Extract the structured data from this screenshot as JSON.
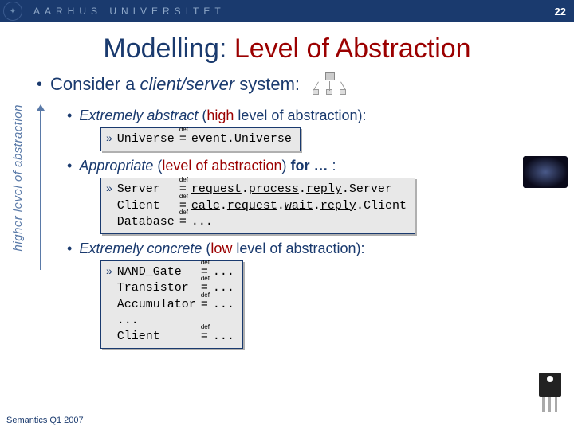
{
  "header": {
    "university": "AARHUS UNIVERSITET",
    "page_number": "22"
  },
  "title": {
    "plain": "Modelling: ",
    "accent": "Level of Abstraction"
  },
  "main_bullet": {
    "prefix": "Consider a ",
    "italic": "client/server",
    "suffix": " system:"
  },
  "vertical_label": "higher level of abstraction",
  "levels": [
    {
      "line_parts": [
        "Extremely abstract",
        " (",
        "high",
        " level of abstraction):"
      ],
      "defs_left": "Universe",
      "defs_right_html": "<span class='u'>event</span>.Universe",
      "rows": 1
    },
    {
      "line_parts": [
        "Appropriate",
        " (",
        "level of abstraction",
        ") ",
        "for …",
        " :"
      ],
      "defs_left": "Server\nClient\nDatabase",
      "defs_right_html": "<span class='u'>request</span>.<span class='u'>process</span>.<span class='u'>reply</span>.Server\n<span class='u'>calc</span>.<span class='u'>request</span>.<span class='u'>wait</span>.<span class='u'>reply</span>.Client\n...",
      "rows": 3
    },
    {
      "line_parts": [
        "Extremely concrete",
        " (",
        "low",
        " level of abstraction):"
      ],
      "defs_left": "NAND_Gate\nTransistor\nAccumulator\n...\nClient",
      "defs_right_html": "...\n...\n...\n \n...",
      "rows": 5,
      "eq_rows": [
        true,
        true,
        true,
        false,
        true
      ]
    }
  ],
  "footer": "Semantics Q1 2007"
}
